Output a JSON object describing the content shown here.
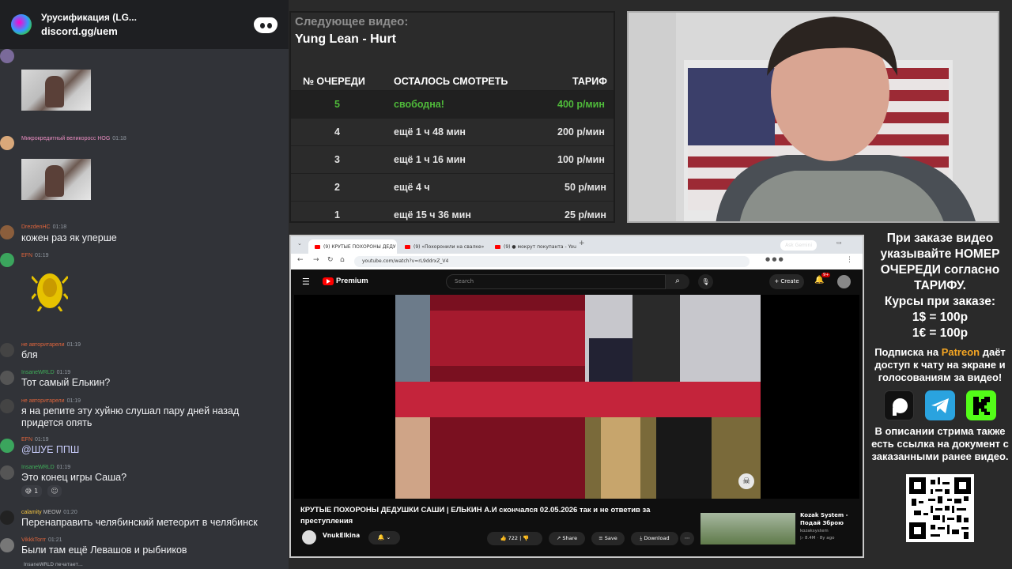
{
  "discord": {
    "server_name": "Урусификация (LG...",
    "invite": "discord.gg/uem",
    "messages": [
      {
        "author": "Микрокредитный великоросс",
        "badge": "HOG",
        "time": "01:18",
        "author_color": "#e98cc0"
      },
      {
        "author": "DrezdenHC",
        "time": "01:18",
        "text": "кожен раз як уперше",
        "author_color": "#e0653c"
      },
      {
        "author": "EFN",
        "time": "01:19",
        "author_color": "#e0653c"
      },
      {
        "author": "не авторитарели",
        "time": "01:19",
        "text": "бля",
        "author_color": "#e0653c"
      },
      {
        "author": "InsaneWRLD",
        "time": "01:19",
        "text": "Тот самый Елькин?",
        "author_color": "#3fae5a"
      },
      {
        "author": "не авторитарели",
        "time": "01:19",
        "text": "я на репите эту хуйню слушал пару дней назад",
        "text2": "придется опять",
        "author_color": "#e0653c"
      },
      {
        "author": "EFN",
        "time": "01:19",
        "text": "@ШУЕ ППШ",
        "author_color": "#e0653c"
      },
      {
        "author": "InsaneWRLD",
        "time": "01:19",
        "text": "Это конец игры Саша?",
        "reaction_count": "1",
        "author_color": "#3fae5a"
      },
      {
        "author": "calamity",
        "badge": "MEOW",
        "time": "01:20",
        "text": "Перенаправить челябинский метеорит в челябинск",
        "author_color": "#f5c542"
      },
      {
        "author": "VikkkTorrr",
        "time": "01:21",
        "text": "Были там ещё Левашов и рыбников",
        "author_color": "#e0653c"
      }
    ],
    "typing": "InsaneWRLD печатает..."
  },
  "queue": {
    "next_label": "Следующее видео:",
    "next_song": "Yung Lean - Hurt",
    "headers": [
      "№ ОЧЕРЕДИ",
      "ОСТАЛОСЬ СМОТРЕТЬ",
      "ТАРИФ"
    ],
    "rows": [
      {
        "num": "5",
        "left": "свободна!",
        "price": "400 р/мин"
      },
      {
        "num": "4",
        "left": "ещё 1 ч 48 мин",
        "price": "200 р/мин"
      },
      {
        "num": "3",
        "left": "ещё 1 ч 16 мин",
        "price": "100 р/мин"
      },
      {
        "num": "2",
        "left": "ещё 4 ч",
        "price": "50 р/мин"
      },
      {
        "num": "1",
        "left": "ещё 15 ч 36 мин",
        "price": "25 р/мин"
      }
    ]
  },
  "browser": {
    "tabs": [
      "(9) КРУТЫЕ ПОХОРОНЫ ДЕДУ",
      "(9) «Похоронили на свалке»",
      "(9) ● мокрут покупанта - You"
    ],
    "ask_gemini": "Ask Gemini",
    "url": "youtube.com/watch?v=rL9ddrxZ_V4",
    "brand": "Premium",
    "search_placeholder": "Search",
    "create": "+ Create",
    "notif_count": "9+",
    "video_title": "КРУТЫЕ ПОХОРОНЫ ДЕДУШКИ САШИ | ЕЛЬКИН А.И скончался 02.05.2026 так и не ответив за преступления",
    "channel": "VnukElkina",
    "likes": "722",
    "share": "Share",
    "save": "Save",
    "download": "Download",
    "reco_title": "Kozak System -",
    "reco_title2": "Подай Зброю",
    "reco_channel": "kozaksystem",
    "reco_meta": "▷ 8.4M · 8y ago"
  },
  "info": {
    "p1": "При заказе видео указывайте НОМЕР ОЧЕРЕДИ согласно ТАРИФУ.",
    "rates_title": "Курсы при заказе:",
    "rate_usd": "1$ = 100р",
    "rate_eur": "1€ = 100р",
    "sub_pre": "Подписка на",
    "sub_brand": "Patreon",
    "sub_post": "даёт доступ к чату на экране и голосованиям за видео!",
    "p3": "В описании стрима также есть ссылка на документ с заказанными ранее видео."
  },
  "colors": {
    "accent_green": "#4fba3a",
    "patreon": "#f5a623",
    "discord_bg": "#313338"
  }
}
